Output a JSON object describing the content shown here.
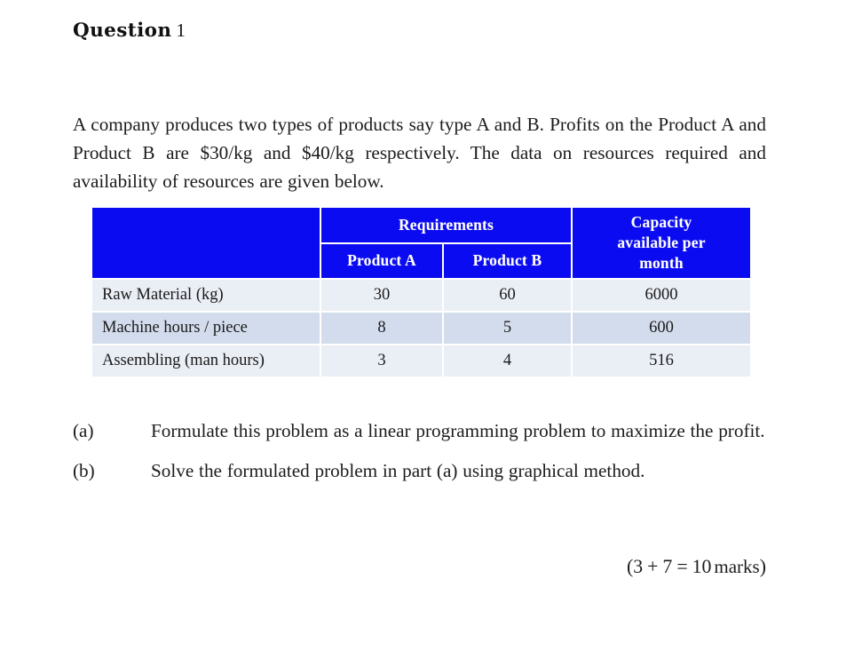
{
  "document": {
    "heading_label": "Question",
    "heading_number": "1",
    "intro_paragraph": "A company produces two types of products say type A and B. Profits on the Product A and Product B are $30/kg and $40/kg respectively. The data on resources required and availability of resources are given below."
  },
  "table": {
    "header_blank": "",
    "group_header": "Requirements",
    "columns": {
      "product_a": "Product A",
      "product_b": "Product B",
      "capacity": "Capacity available per month"
    },
    "capacity_lines": [
      "Capacity",
      "available per",
      "month"
    ],
    "rows": [
      {
        "label": "Raw Material (kg)",
        "product_a": "30",
        "product_b": "60",
        "capacity": "6000"
      },
      {
        "label": "Machine hours / piece",
        "product_a": "8",
        "product_b": "5",
        "capacity": "600"
      },
      {
        "label": "Assembling (man hours)",
        "product_a": "3",
        "product_b": "4",
        "capacity": "516"
      }
    ],
    "colors": {
      "header_blue": "#0b0bf2",
      "header_text": "#ffffff",
      "band_light": "#eaeef5",
      "band_dark": "#d3dced",
      "gap": "#ffffff"
    }
  },
  "questions": [
    {
      "marker": "(a)",
      "text": "Formulate this problem as a linear programming problem to maximize the profit."
    },
    {
      "marker": "(b)",
      "text": "Solve the formulated problem in part (a) using graphical method."
    }
  ],
  "marks": {
    "open_paren": "(",
    "first": "3",
    "plus": "+",
    "second": "7",
    "equals": "=",
    "total": "10",
    "unit": "marks",
    "close_paren": ")"
  }
}
